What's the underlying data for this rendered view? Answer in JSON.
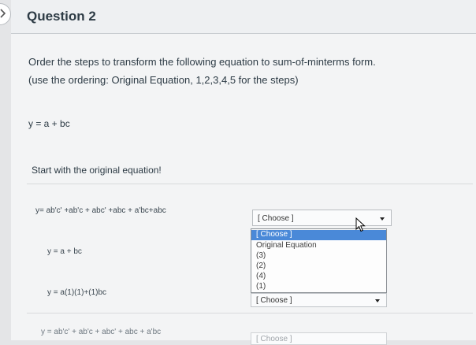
{
  "question": {
    "title": "Question 2",
    "prompt_line1": "Order the steps to transform the following equation to sum-of-minterms form.",
    "prompt_line2": "(use the ordering: Original Equation, 1,2,3,4,5 for the steps)",
    "equation": "y = a + bc",
    "instruction": "Start with the original equation!"
  },
  "rows": [
    {
      "label": "y= ab'c' +ab'c + abc' +abc + a'bc+abc",
      "select_value": "[ Choose ]"
    },
    {
      "label": "y = a + bc"
    },
    {
      "label": "y = a(1)(1)+(1)bc",
      "select_value": "[ Choose ]"
    },
    {
      "label": "y = ab'c' + ab'c + abc' + abc + a'bc",
      "select_value": "[ Choose ]"
    }
  ],
  "dropdown_options": [
    "[ Choose ]",
    "Original Equation",
    "(3)",
    "(2)",
    "(4)",
    "(1)"
  ]
}
